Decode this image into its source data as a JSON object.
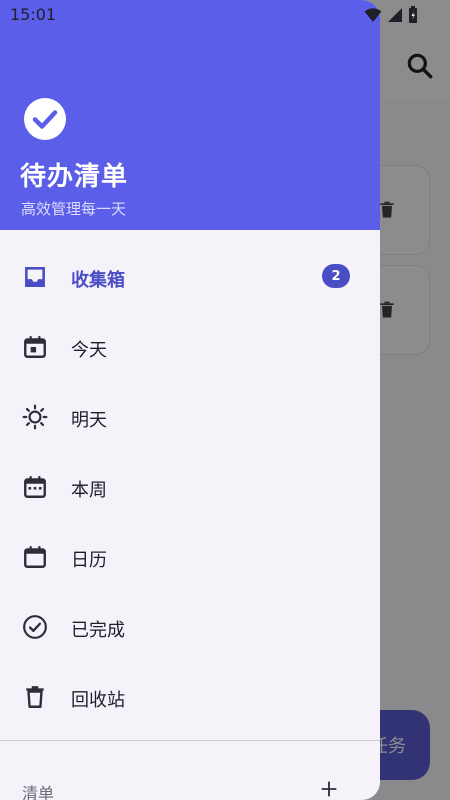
{
  "status_bar": {
    "time": "15:01",
    "icons": [
      "wifi-icon",
      "cellular-signal-icon",
      "battery-icon"
    ]
  },
  "background": {
    "fab_label": "任务",
    "icons": [
      "search-icon",
      "trash-icon"
    ]
  },
  "drawer": {
    "header": {
      "logo_icon": "check-circle-icon",
      "title": "待办清单",
      "subtitle": "高效管理每一天"
    },
    "nav_items": [
      {
        "label": "收集箱",
        "icon": "inbox-icon",
        "badge": "2",
        "active": true
      },
      {
        "label": "今天",
        "icon": "calendar-today-icon"
      },
      {
        "label": "明天",
        "icon": "sun-icon"
      },
      {
        "label": "本周",
        "icon": "calendar-week-icon"
      },
      {
        "label": "日历",
        "icon": "calendar-icon"
      },
      {
        "label": "已完成",
        "icon": "check-circle-outline-icon"
      },
      {
        "label": "回收站",
        "icon": "trash-icon"
      }
    ],
    "lists_section": {
      "label": "清单",
      "add_icon": "plus-icon"
    }
  },
  "colors": {
    "accent": "#5b5ee8",
    "active_text": "#4a4ec4",
    "drawer_bg": "#f5f2fa"
  }
}
